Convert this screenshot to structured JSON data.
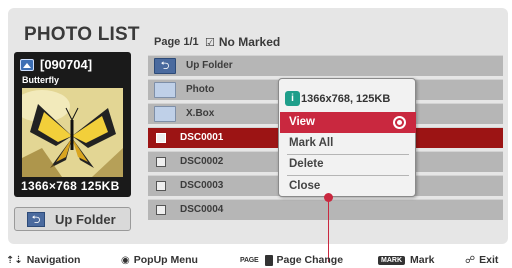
{
  "header": {
    "title": "PHOTO LIST",
    "page": "Page 1/1",
    "marked_checkbox": "☑",
    "marked": "No Marked"
  },
  "preview": {
    "icon": "photo-icon",
    "date": "[090704]",
    "name": "Butterfly",
    "resolution_size": "1366×768 125KB"
  },
  "up_folder_button": {
    "icon": "up-arrow-icon",
    "label": "Up Folder"
  },
  "list": {
    "items": [
      {
        "label": "Up Folder",
        "icon": "up-folder-icon"
      },
      {
        "label": "Photo",
        "icon": "folder-icon"
      },
      {
        "label": "X.Box",
        "icon": "folder-icon"
      },
      {
        "label": "DSC0001",
        "checked": false,
        "selected": true
      },
      {
        "label": "DSC0002",
        "checked": false
      },
      {
        "label": "DSC0003",
        "checked": false
      },
      {
        "label": "DSC0004",
        "checked": false
      }
    ]
  },
  "popup": {
    "info_icon_letter": "i",
    "info_text": "1366x768, 125KB",
    "items": [
      "View",
      "Mark All",
      "Delete",
      "Close"
    ],
    "active_item": "View"
  },
  "footer": {
    "navigation": {
      "icon": "⇡⇣",
      "label": "Navigation"
    },
    "popup_menu": {
      "icon": "◉",
      "label": "PopUp Menu"
    },
    "page_change": {
      "icon": "PAGE",
      "label": "Page Change"
    },
    "mark": {
      "icon": "MARK",
      "label": "Mark"
    },
    "exit": {
      "icon": "☍",
      "label": "Exit"
    }
  },
  "colors": {
    "accent": "#c9283f",
    "selected_row": "#9c1414",
    "panel": "#e6e6e6",
    "row": "#b6b6b6"
  }
}
